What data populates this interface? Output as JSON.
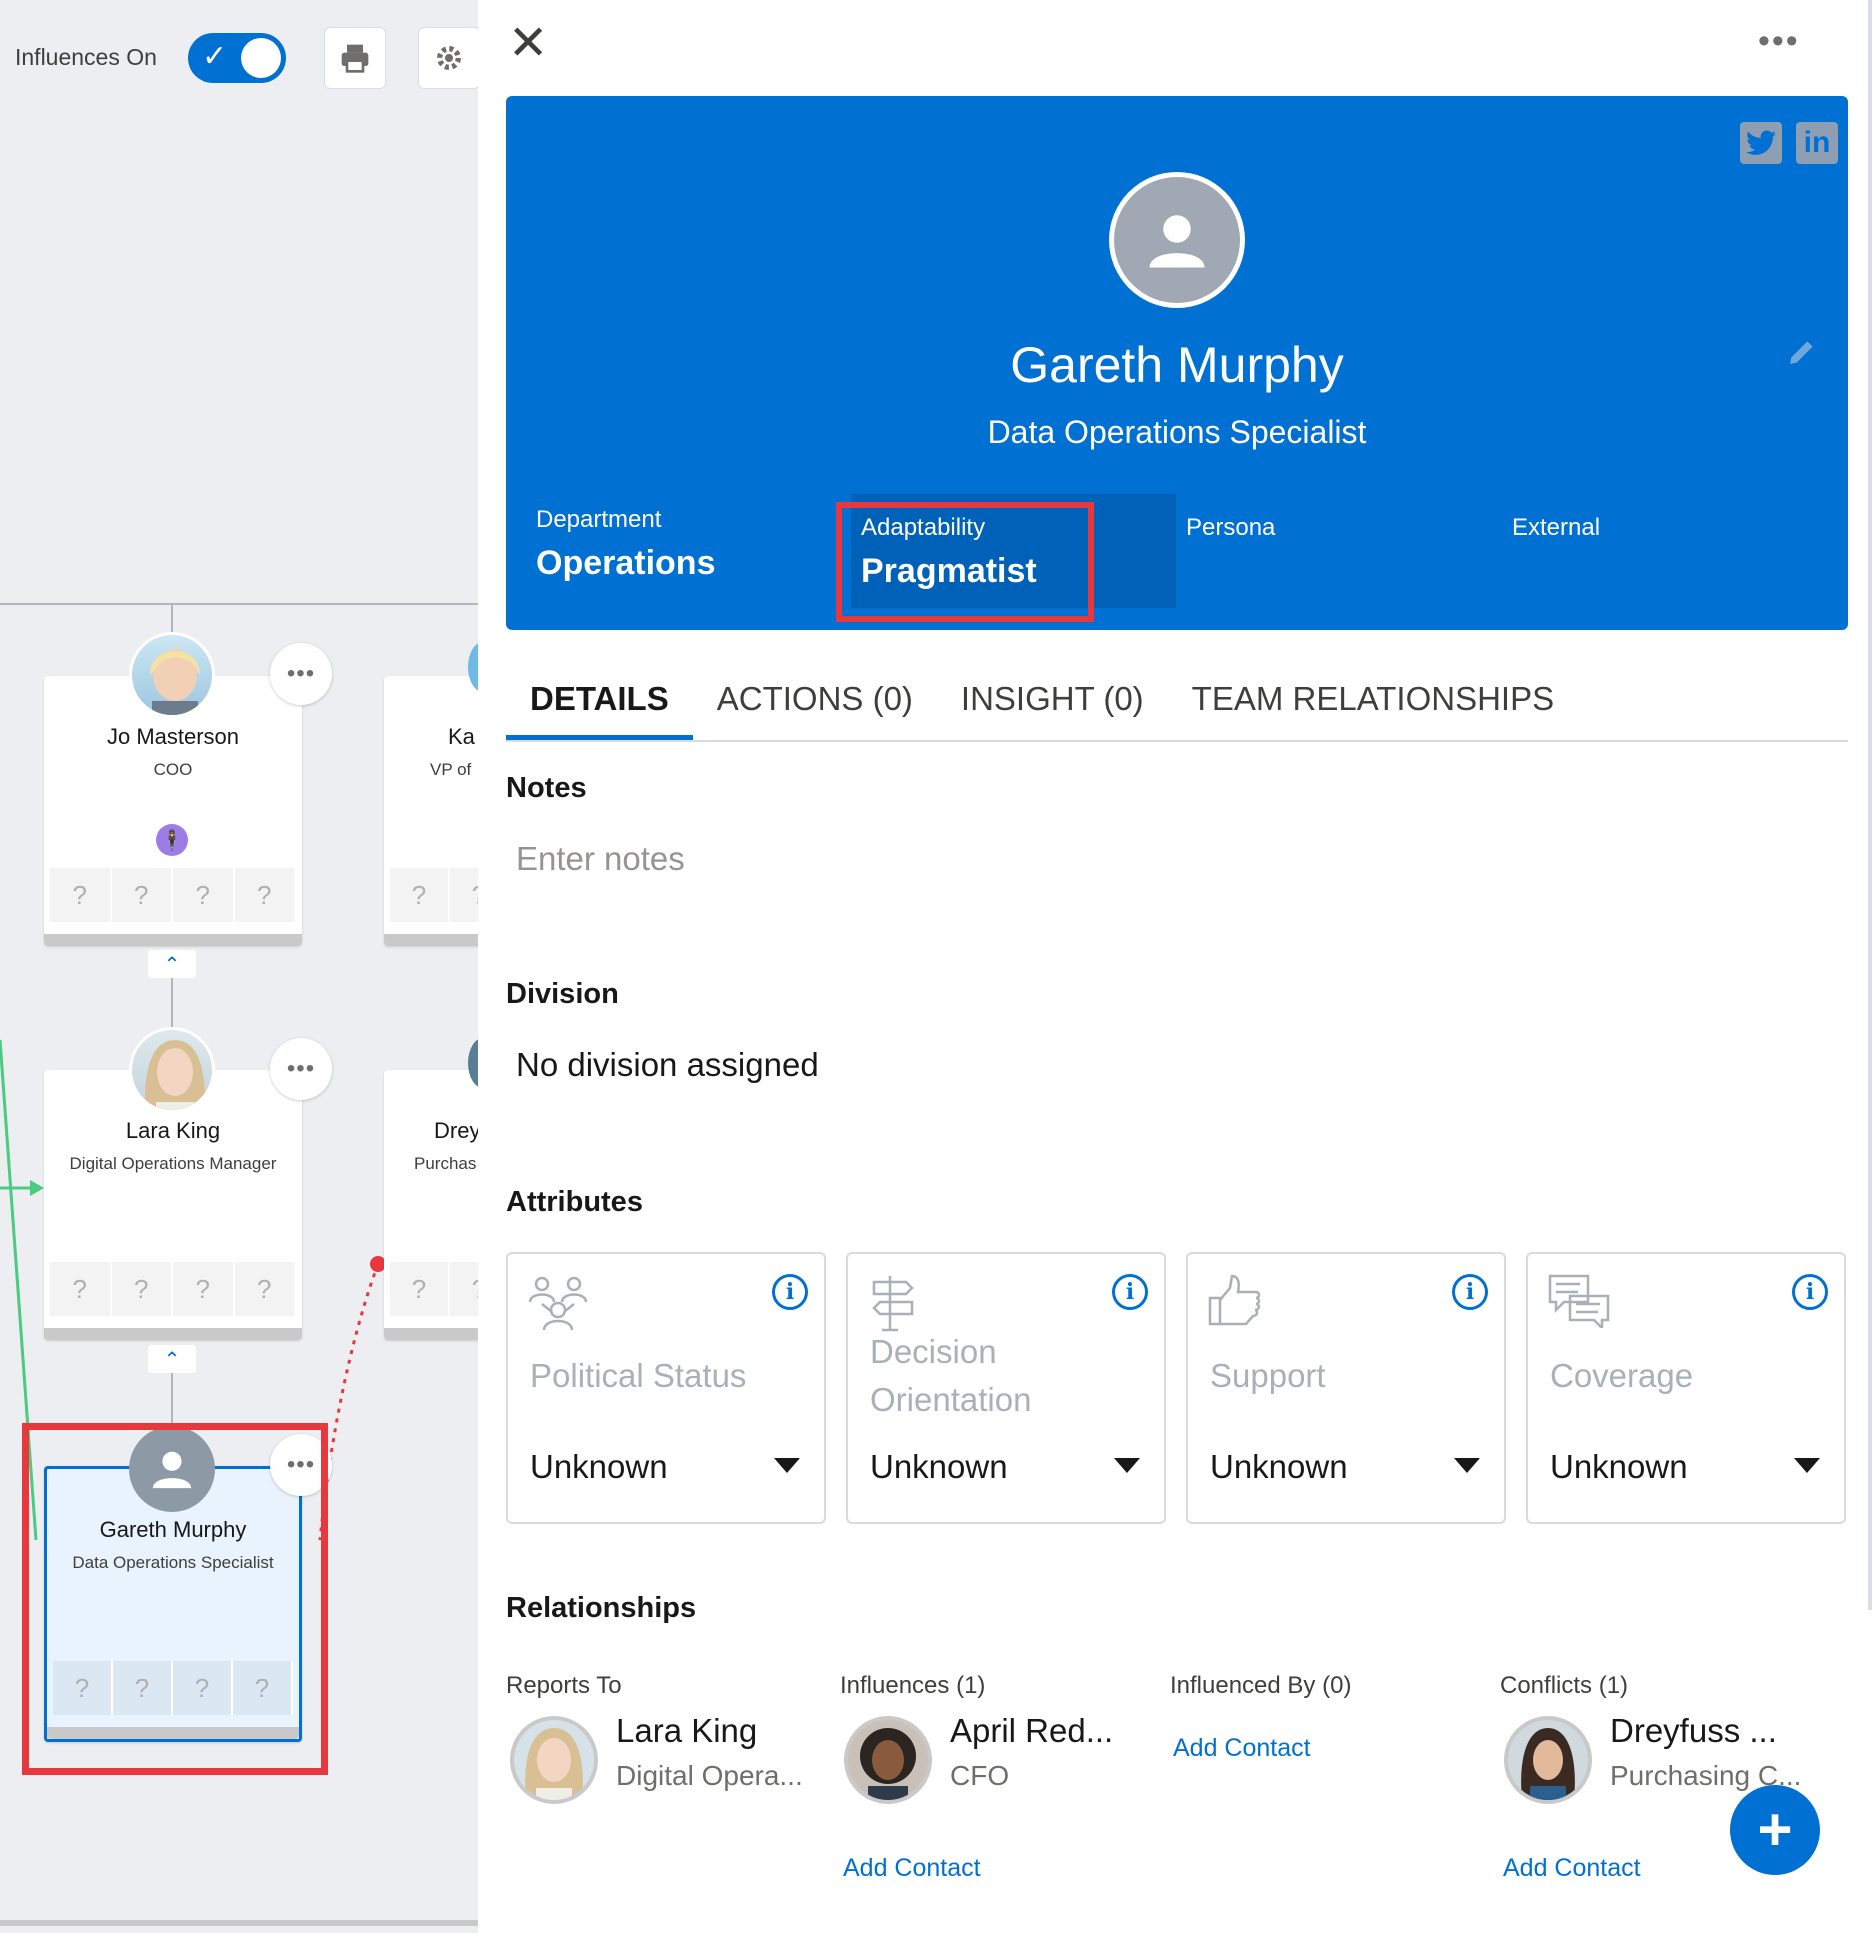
{
  "toolbar": {
    "influences_label": "Influences On",
    "influences_on": true,
    "print_icon": "printer-icon",
    "settings_icon": "gear-icon"
  },
  "org_chart": {
    "cards": [
      {
        "name": "Jo Masterson",
        "title": "COO",
        "has_badge": true,
        "badge_icon": "person-badge-icon",
        "questions": [
          "?",
          "?",
          "?",
          "?"
        ]
      },
      {
        "name": "Ka",
        "title": "VP of",
        "questions": [
          "?",
          "?"
        ]
      },
      {
        "name": "Lara King",
        "title": "Digital Operations Manager",
        "questions": [
          "?",
          "?",
          "?",
          "?"
        ]
      },
      {
        "name": "Drey",
        "title": "Purchas",
        "questions": [
          "?",
          "?"
        ]
      },
      {
        "name": "Gareth Murphy",
        "title": "Data Operations Specialist",
        "selected": true,
        "questions": [
          "?",
          "?",
          "?",
          "?"
        ]
      }
    ],
    "more_label": "•••"
  },
  "panel": {
    "close_icon": "close-icon",
    "more_label": "•••",
    "social": {
      "twitter": "twitter-icon",
      "linkedin": "in"
    },
    "name": "Gareth Murphy",
    "role": "Data Operations Specialist",
    "fields": [
      {
        "label": "Department",
        "value": "Operations"
      },
      {
        "label": "Adaptability",
        "value": "Pragmatist"
      },
      {
        "label": "Persona",
        "value": ""
      },
      {
        "label": "External",
        "value": ""
      }
    ],
    "tabs": [
      "DETAILS",
      "ACTIONS (0)",
      "INSIGHT (0)",
      "TEAM RELATIONSHIPS"
    ],
    "active_tab": 0,
    "notes": {
      "heading": "Notes",
      "placeholder": "Enter notes"
    },
    "division": {
      "heading": "Division",
      "value": "No division assigned"
    },
    "attributes": {
      "heading": "Attributes",
      "info_glyph": "i",
      "items": [
        {
          "name": "Political Status",
          "value": "Unknown",
          "icon": "people-network-icon"
        },
        {
          "name": "Decision Orientation",
          "value": "Unknown",
          "icon": "signpost-icon"
        },
        {
          "name": "Support",
          "value": "Unknown",
          "icon": "thumbs-up-icon"
        },
        {
          "name": "Coverage",
          "value": "Unknown",
          "icon": "chat-bubbles-icon"
        }
      ]
    },
    "relationships": {
      "heading": "Relationships",
      "reports_to": {
        "label": "Reports To",
        "name": "Lara King",
        "sub": "Digital Opera..."
      },
      "influences": {
        "label": "Influences (1)",
        "name": "April Red...",
        "sub": "CFO",
        "add": "Add Contact"
      },
      "influenced_by": {
        "label": "Influenced By (0)",
        "add": "Add Contact"
      },
      "conflicts": {
        "label": "Conflicts (1)",
        "name": "Dreyfuss ...",
        "sub": "Purchasing C...",
        "add": "Add Contact"
      }
    },
    "fab_label": "+"
  },
  "colors": {
    "brand": "#0070d2",
    "highlight": "#e8383d",
    "canvas": "#eceef1"
  }
}
